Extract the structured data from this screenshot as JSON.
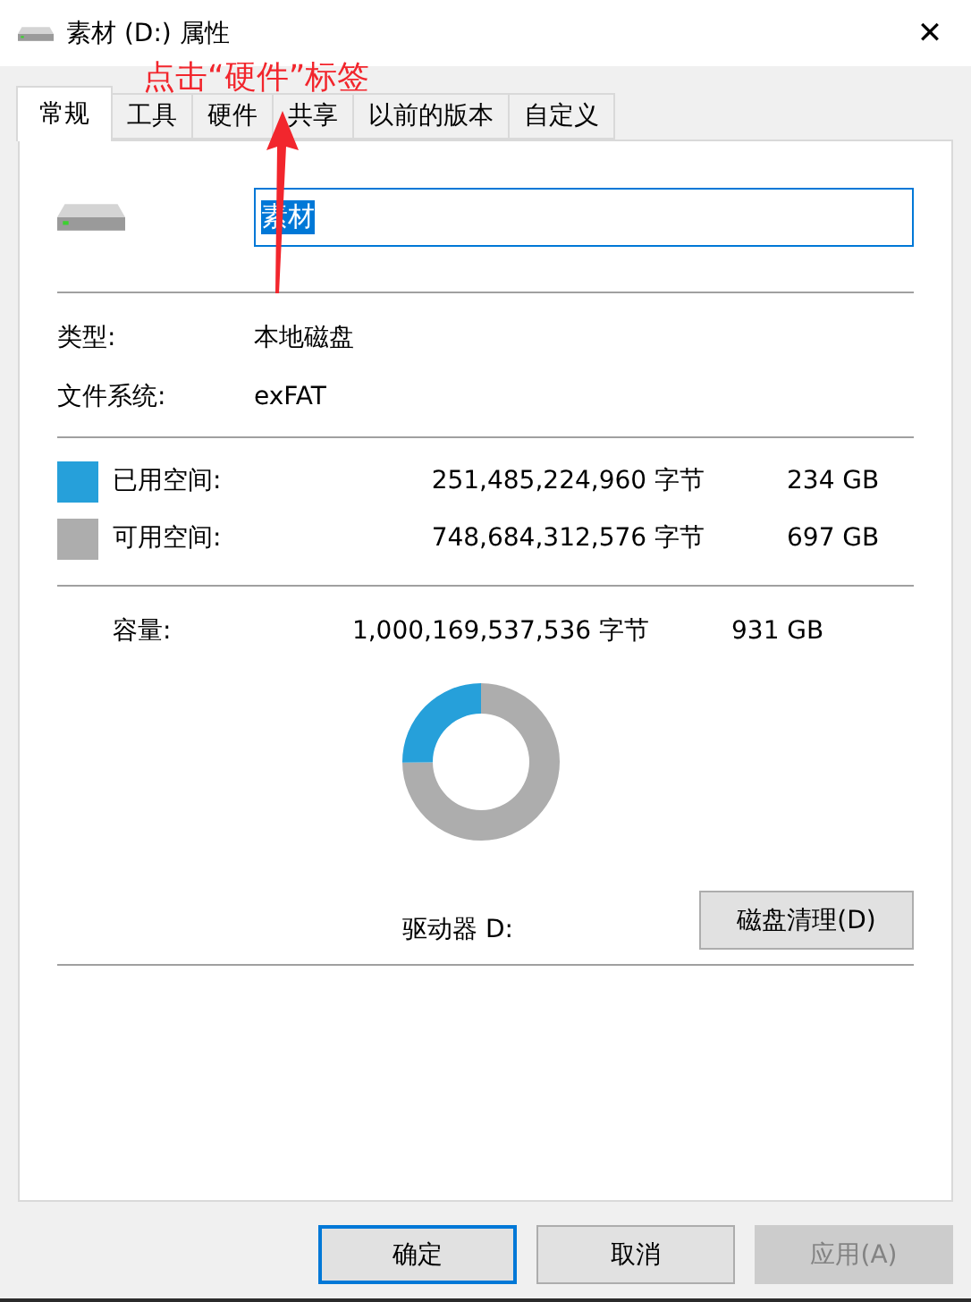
{
  "window": {
    "title": "素材 (D:) 属性",
    "close": "✕"
  },
  "annotation": {
    "text": "点击“硬件”标签"
  },
  "tabs": [
    {
      "label": "常规",
      "selected": true
    },
    {
      "label": "工具",
      "selected": false
    },
    {
      "label": "硬件",
      "selected": false
    },
    {
      "label": "共享",
      "selected": false
    },
    {
      "label": "以前的版本",
      "selected": false
    },
    {
      "label": "自定义",
      "selected": false
    }
  ],
  "name_field": {
    "value": "素材"
  },
  "info": [
    {
      "label": "类型:",
      "value": "本地磁盘"
    },
    {
      "label": "文件系统:",
      "value": "exFAT"
    }
  ],
  "usage": [
    {
      "label": "已用空间:",
      "bytes": "251,485,224,960 字节",
      "size": "234 GB",
      "color": "#26a0da"
    },
    {
      "label": "可用空间:",
      "bytes": "748,684,312,576 字节",
      "size": "697 GB",
      "color": "#adadad"
    }
  ],
  "capacity": {
    "label": "容量:",
    "bytes": "1,000,169,537,536 字节",
    "size": "931 GB"
  },
  "chart_data": {
    "type": "donut",
    "values": [
      25.14,
      74.86
    ]
  },
  "drive_label": "驱动器 D:",
  "cleanup_button": "磁盘清理(D)",
  "buttons": [
    {
      "label": "确定",
      "kind": "default",
      "disabled": false
    },
    {
      "label": "取消",
      "kind": "normal",
      "disabled": false
    },
    {
      "label": "应用(A)",
      "kind": "normal",
      "disabled": true
    }
  ]
}
